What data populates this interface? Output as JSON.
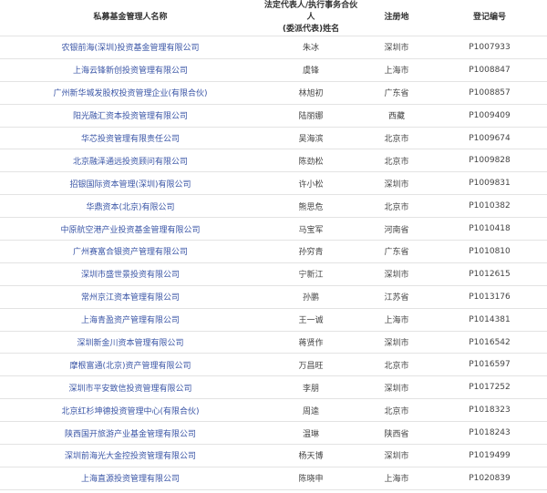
{
  "headers": {
    "name": "私募基金管理人名称",
    "rep_line1": "法定代表人/执行事务合伙人",
    "rep_line2": "(委派代表)姓名",
    "location": "注册地",
    "code": "登记编号"
  },
  "rows": [
    {
      "name": "农银前海(深圳)投资基金管理有限公司",
      "rep": "朱冰",
      "location": "深圳市",
      "code": "P1007933"
    },
    {
      "name": "上海云锋新创投资管理有限公司",
      "rep": "虞锋",
      "location": "上海市",
      "code": "P1008847"
    },
    {
      "name": "广州新华城发股权投资管理企业(有限合伙)",
      "rep": "林旭初",
      "location": "广东省",
      "code": "P1008857"
    },
    {
      "name": "阳光融汇资本投资管理有限公司",
      "rep": "陆丽娜",
      "location": "西藏",
      "code": "P1009409"
    },
    {
      "name": "华芯投资管理有限责任公司",
      "rep": "吴海滨",
      "location": "北京市",
      "code": "P1009674"
    },
    {
      "name": "北京融泽通远投资顾问有限公司",
      "rep": "陈劲松",
      "location": "北京市",
      "code": "P1009828"
    },
    {
      "name": "招银国际资本管理(深圳)有限公司",
      "rep": "许小松",
      "location": "深圳市",
      "code": "P1009831"
    },
    {
      "name": "华鼎资本(北京)有限公司",
      "rep": "熊思危",
      "location": "北京市",
      "code": "P1010382"
    },
    {
      "name": "中原航空港产业投资基金管理有限公司",
      "rep": "马宝军",
      "location": "河南省",
      "code": "P1010418"
    },
    {
      "name": "广州赛富合银资产管理有限公司",
      "rep": "孙穷青",
      "location": "广东省",
      "code": "P1010810"
    },
    {
      "name": "深圳市盛世景投资有限公司",
      "rep": "宁新江",
      "location": "深圳市",
      "code": "P1012615"
    },
    {
      "name": "常州京江资本管理有限公司",
      "rep": "孙鹏",
      "location": "江苏省",
      "code": "P1013176"
    },
    {
      "name": "上海青盈资产管理有限公司",
      "rep": "王一诚",
      "location": "上海市",
      "code": "P1014381"
    },
    {
      "name": "深圳新金川资本管理有限公司",
      "rep": "蒋贤作",
      "location": "深圳市",
      "code": "P1016542"
    },
    {
      "name": "摩根富通(北京)资产管理有限公司",
      "rep": "万昌旺",
      "location": "北京市",
      "code": "P1016597"
    },
    {
      "name": "深圳市平安致信投资管理有限公司",
      "rep": "李朋",
      "location": "深圳市",
      "code": "P1017252"
    },
    {
      "name": "北京红杉坤德投资管理中心(有限合伙)",
      "rep": "周逵",
      "location": "北京市",
      "code": "P1018323"
    },
    {
      "name": "陕西国开旅游产业基金管理有限公司",
      "rep": "温琳",
      "location": "陕西省",
      "code": "P1018243"
    },
    {
      "name": "深圳前海光大金控投资管理有限公司",
      "rep": "杨天博",
      "location": "深圳市",
      "code": "P1019499"
    },
    {
      "name": "上海直源投资管理有限公司",
      "rep": "陈晓申",
      "location": "上海市",
      "code": "P1020839"
    }
  ]
}
